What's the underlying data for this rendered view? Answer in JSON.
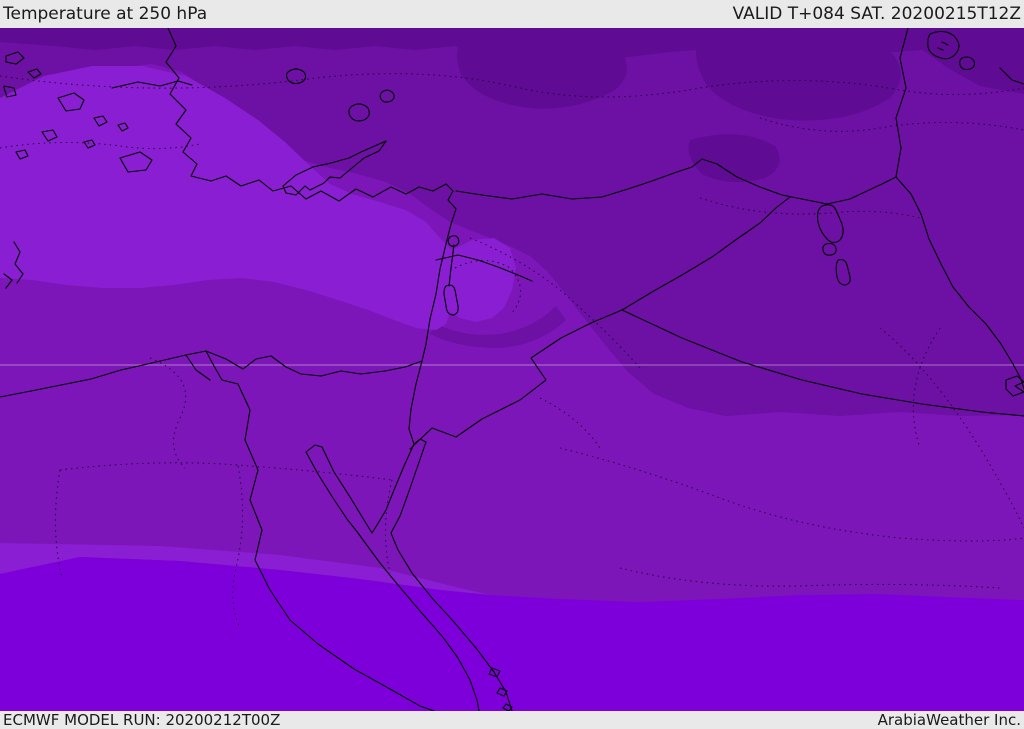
{
  "header": {
    "title": "Temperature at 250 hPa",
    "valid": "VALID T+084 SAT. 20200215T12Z"
  },
  "footer": {
    "model_run": "ECMWF MODEL RUN: 20200212T00Z",
    "credit": "ArabiaWeather Inc."
  },
  "map": {
    "parameter": "Temperature at 250 hPa",
    "shading": [
      {
        "name": "band-darkest",
        "color": "#5f0b94"
      },
      {
        "name": "band-dark",
        "color": "#6d10a4"
      },
      {
        "name": "band-medium",
        "color": "#7c16b8"
      },
      {
        "name": "band-bright",
        "color": "#8a1ed2"
      },
      {
        "name": "band-violet",
        "color": "#7d00da"
      }
    ],
    "coastline_color": "#000000",
    "contour_color": "#1d0030",
    "gridline_color": "#d8c8e4"
  }
}
